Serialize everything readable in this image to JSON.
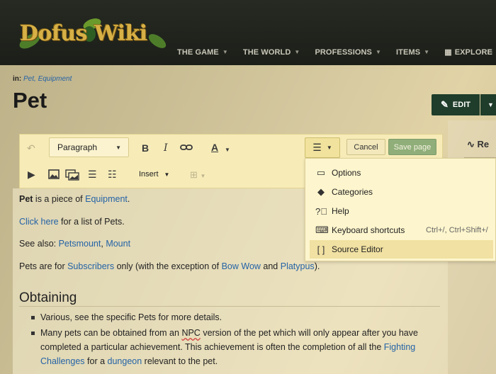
{
  "site": {
    "logo_text": "Dofus Wiki",
    "nav": [
      "THE GAME",
      "THE WORLD",
      "PROFESSIONS",
      "ITEMS",
      "EXPLORE"
    ]
  },
  "page": {
    "breadcrumb_prefix": "in:",
    "categories": "Pet, Equipment",
    "title": "Pet",
    "edit_label": "EDIT",
    "rail_label": "Re"
  },
  "toolbar": {
    "format": "Paragraph",
    "bold": "B",
    "italic": "I",
    "style": "A",
    "cancel": "Cancel",
    "save": "Save page",
    "insert": "Insert"
  },
  "menu": {
    "items": [
      {
        "label": "Options",
        "icon": "options-icon",
        "shortcut": ""
      },
      {
        "label": "Categories",
        "icon": "tag-icon",
        "shortcut": ""
      },
      {
        "label": "Help",
        "icon": "help-icon",
        "shortcut": ""
      },
      {
        "label": "Keyboard shortcuts",
        "icon": "keyboard-icon",
        "shortcut": "Ctrl+/, Ctrl+Shift+/"
      },
      {
        "label": "Source Editor",
        "icon": "brackets-icon",
        "shortcut": ""
      }
    ]
  },
  "content": {
    "p1_bold": "Pet",
    "p1_mid": " is a piece of ",
    "p1_link": "Equipment",
    "p1_end": ".",
    "p2_link": "Click here",
    "p2_end": " for a list of Pets.",
    "p3_pre": "See also: ",
    "p3_link1": "Petsmount",
    "p3_sep": ", ",
    "p3_link2": "Mount",
    "p4_pre": "Pets are for ",
    "p4_link1": "Subscribers",
    "p4_mid1": " only (with the exception of ",
    "p4_link2": "Bow Wow",
    "p4_mid2": " and ",
    "p4_link3": "Platypus",
    "p4_end": ").",
    "section": "Obtaining",
    "li1": "Various, see the specific Pets for more details.",
    "li2_a": "Many pets can be obtained from an ",
    "li2_npc": "NPC",
    "li2_b": " version of the pet which will only appear after you have completed a particular achievement. This achievement is often the completion of all the ",
    "li2_link1": "Fighting Challenges",
    "li2_c": " for a ",
    "li2_link2": "dungeon",
    "li2_d": " relevant to the pet."
  },
  "colors": {
    "topbar": "#1c1f19",
    "edit_button": "#1f3d2a",
    "save_button": "#8fae79",
    "link": "#2463a6"
  }
}
